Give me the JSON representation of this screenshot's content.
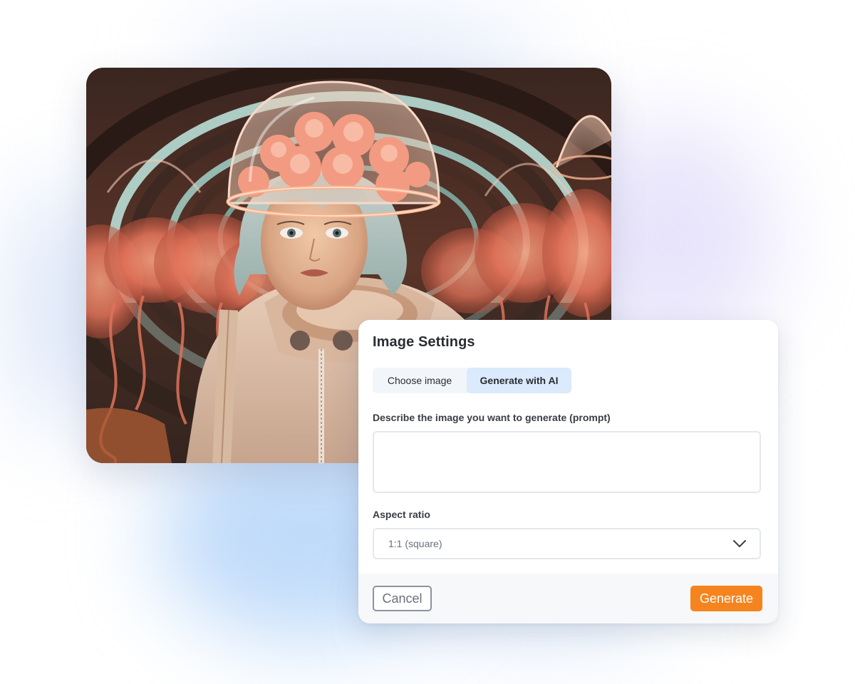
{
  "hero": {
    "image_description_icon": "astronaut-girl-with-jellyfish-helmet-photo"
  },
  "dialog": {
    "title": "Image Settings",
    "tabs": [
      {
        "label": "Choose image",
        "selected": false
      },
      {
        "label": "Generate with AI",
        "selected": true
      }
    ],
    "prompt": {
      "label": "Describe the image you want to generate (prompt)",
      "value": "",
      "placeholder": ""
    },
    "aspect_ratio": {
      "label": "Aspect ratio",
      "selected": "1:1 (square)",
      "icon": "chevron-down-icon"
    },
    "footer": {
      "cancel_label": "Cancel",
      "generate_label": "Generate"
    }
  },
  "colors": {
    "accent": "#f5841f",
    "tab_selected_bg": "#dbeafc",
    "tabs_bg": "#f2f6fb",
    "title_text": "#2a2d33",
    "border": "#e4e8ee"
  }
}
